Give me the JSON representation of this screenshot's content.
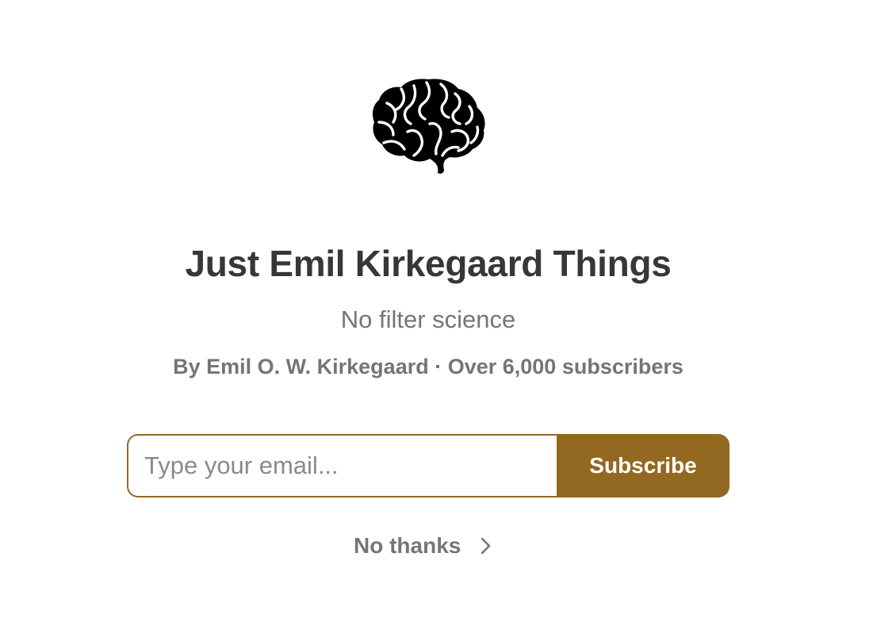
{
  "publication": {
    "logo_icon": "brain-icon",
    "title": "Just Emil Kirkegaard Things",
    "subtitle": "No filter science",
    "byline": "By Emil O. W. Kirkegaard · Over 6,000 subscribers"
  },
  "subscribe_form": {
    "email_placeholder": "Type your email...",
    "email_value": "",
    "subscribe_label": "Subscribe"
  },
  "no_thanks": {
    "label": "No thanks",
    "icon": "chevron-right-icon"
  },
  "colors": {
    "accent": "#936820",
    "title_text": "#363737",
    "muted_text": "#757575",
    "background": "#ffffff"
  }
}
